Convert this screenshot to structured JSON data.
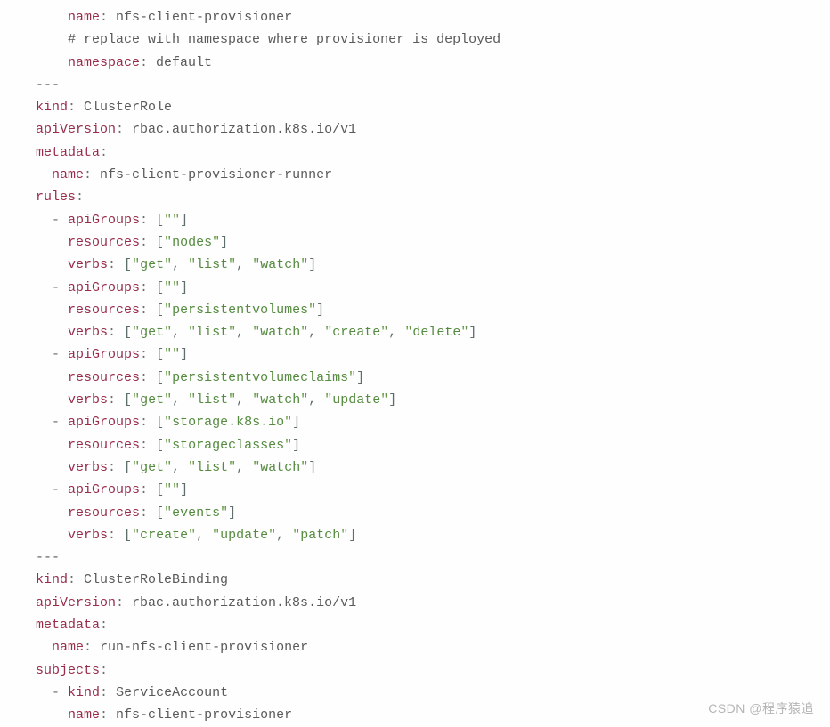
{
  "watermark": "CSDN @程序猿追",
  "lines": [
    {
      "indent": "    ",
      "tokens": [
        {
          "t": "key",
          "v": "name"
        },
        {
          "t": "col",
          "v": ": "
        },
        {
          "t": "pl",
          "v": "nfs-client-provisioner"
        }
      ]
    },
    {
      "indent": "    ",
      "tokens": [
        {
          "t": "pl",
          "v": "# replace with namespace where provisioner is deployed"
        }
      ]
    },
    {
      "indent": "    ",
      "tokens": [
        {
          "t": "key",
          "v": "namespace"
        },
        {
          "t": "col",
          "v": ": "
        },
        {
          "t": "pl",
          "v": "default"
        }
      ]
    },
    {
      "indent": "",
      "tokens": [
        {
          "t": "sep",
          "v": "---"
        }
      ]
    },
    {
      "indent": "",
      "tokens": [
        {
          "t": "key",
          "v": "kind"
        },
        {
          "t": "col",
          "v": ": "
        },
        {
          "t": "pl",
          "v": "ClusterRole"
        }
      ]
    },
    {
      "indent": "",
      "tokens": [
        {
          "t": "key",
          "v": "apiVersion"
        },
        {
          "t": "col",
          "v": ": "
        },
        {
          "t": "pl",
          "v": "rbac.authorization.k8s.io/v1"
        }
      ]
    },
    {
      "indent": "",
      "tokens": [
        {
          "t": "key",
          "v": "metadata"
        },
        {
          "t": "col",
          "v": ":"
        }
      ]
    },
    {
      "indent": "  ",
      "tokens": [
        {
          "t": "key",
          "v": "name"
        },
        {
          "t": "col",
          "v": ": "
        },
        {
          "t": "pl",
          "v": "nfs-client-provisioner-runner"
        }
      ]
    },
    {
      "indent": "",
      "tokens": [
        {
          "t": "key",
          "v": "rules"
        },
        {
          "t": "col",
          "v": ":"
        }
      ]
    },
    {
      "indent": "  ",
      "tokens": [
        {
          "t": "dash",
          "v": "- "
        },
        {
          "t": "key",
          "v": "apiGroups"
        },
        {
          "t": "col",
          "v": ": "
        },
        {
          "t": "b",
          "v": "["
        },
        {
          "t": "q",
          "v": "\""
        },
        {
          "t": "s",
          "v": ""
        },
        {
          "t": "q",
          "v": "\""
        },
        {
          "t": "b",
          "v": "]"
        }
      ]
    },
    {
      "indent": "    ",
      "tokens": [
        {
          "t": "key",
          "v": "resources"
        },
        {
          "t": "col",
          "v": ": "
        },
        {
          "t": "b",
          "v": "["
        },
        {
          "t": "q",
          "v": "\""
        },
        {
          "t": "s",
          "v": "nodes"
        },
        {
          "t": "q",
          "v": "\""
        },
        {
          "t": "b",
          "v": "]"
        }
      ]
    },
    {
      "indent": "    ",
      "tokens": [
        {
          "t": "key",
          "v": "verbs"
        },
        {
          "t": "col",
          "v": ": "
        },
        {
          "t": "b",
          "v": "["
        },
        {
          "t": "q",
          "v": "\""
        },
        {
          "t": "s",
          "v": "get"
        },
        {
          "t": "q",
          "v": "\""
        },
        {
          "t": "b",
          "v": ", "
        },
        {
          "t": "q",
          "v": "\""
        },
        {
          "t": "s",
          "v": "list"
        },
        {
          "t": "q",
          "v": "\""
        },
        {
          "t": "b",
          "v": ", "
        },
        {
          "t": "q",
          "v": "\""
        },
        {
          "t": "s",
          "v": "watch"
        },
        {
          "t": "q",
          "v": "\""
        },
        {
          "t": "b",
          "v": "]"
        }
      ]
    },
    {
      "indent": "  ",
      "tokens": [
        {
          "t": "dash",
          "v": "- "
        },
        {
          "t": "key",
          "v": "apiGroups"
        },
        {
          "t": "col",
          "v": ": "
        },
        {
          "t": "b",
          "v": "["
        },
        {
          "t": "q",
          "v": "\""
        },
        {
          "t": "s",
          "v": ""
        },
        {
          "t": "q",
          "v": "\""
        },
        {
          "t": "b",
          "v": "]"
        }
      ]
    },
    {
      "indent": "    ",
      "tokens": [
        {
          "t": "key",
          "v": "resources"
        },
        {
          "t": "col",
          "v": ": "
        },
        {
          "t": "b",
          "v": "["
        },
        {
          "t": "q",
          "v": "\""
        },
        {
          "t": "s",
          "v": "persistentvolumes"
        },
        {
          "t": "q",
          "v": "\""
        },
        {
          "t": "b",
          "v": "]"
        }
      ]
    },
    {
      "indent": "    ",
      "tokens": [
        {
          "t": "key",
          "v": "verbs"
        },
        {
          "t": "col",
          "v": ": "
        },
        {
          "t": "b",
          "v": "["
        },
        {
          "t": "q",
          "v": "\""
        },
        {
          "t": "s",
          "v": "get"
        },
        {
          "t": "q",
          "v": "\""
        },
        {
          "t": "b",
          "v": ", "
        },
        {
          "t": "q",
          "v": "\""
        },
        {
          "t": "s",
          "v": "list"
        },
        {
          "t": "q",
          "v": "\""
        },
        {
          "t": "b",
          "v": ", "
        },
        {
          "t": "q",
          "v": "\""
        },
        {
          "t": "s",
          "v": "watch"
        },
        {
          "t": "q",
          "v": "\""
        },
        {
          "t": "b",
          "v": ", "
        },
        {
          "t": "q",
          "v": "\""
        },
        {
          "t": "s",
          "v": "create"
        },
        {
          "t": "q",
          "v": "\""
        },
        {
          "t": "b",
          "v": ", "
        },
        {
          "t": "q",
          "v": "\""
        },
        {
          "t": "s",
          "v": "delete"
        },
        {
          "t": "q",
          "v": "\""
        },
        {
          "t": "b",
          "v": "]"
        }
      ]
    },
    {
      "indent": "  ",
      "tokens": [
        {
          "t": "dash",
          "v": "- "
        },
        {
          "t": "key",
          "v": "apiGroups"
        },
        {
          "t": "col",
          "v": ": "
        },
        {
          "t": "b",
          "v": "["
        },
        {
          "t": "q",
          "v": "\""
        },
        {
          "t": "s",
          "v": ""
        },
        {
          "t": "q",
          "v": "\""
        },
        {
          "t": "b",
          "v": "]"
        }
      ]
    },
    {
      "indent": "    ",
      "tokens": [
        {
          "t": "key",
          "v": "resources"
        },
        {
          "t": "col",
          "v": ": "
        },
        {
          "t": "b",
          "v": "["
        },
        {
          "t": "q",
          "v": "\""
        },
        {
          "t": "s",
          "v": "persistentvolumeclaims"
        },
        {
          "t": "q",
          "v": "\""
        },
        {
          "t": "b",
          "v": "]"
        }
      ]
    },
    {
      "indent": "    ",
      "tokens": [
        {
          "t": "key",
          "v": "verbs"
        },
        {
          "t": "col",
          "v": ": "
        },
        {
          "t": "b",
          "v": "["
        },
        {
          "t": "q",
          "v": "\""
        },
        {
          "t": "s",
          "v": "get"
        },
        {
          "t": "q",
          "v": "\""
        },
        {
          "t": "b",
          "v": ", "
        },
        {
          "t": "q",
          "v": "\""
        },
        {
          "t": "s",
          "v": "list"
        },
        {
          "t": "q",
          "v": "\""
        },
        {
          "t": "b",
          "v": ", "
        },
        {
          "t": "q",
          "v": "\""
        },
        {
          "t": "s",
          "v": "watch"
        },
        {
          "t": "q",
          "v": "\""
        },
        {
          "t": "b",
          "v": ", "
        },
        {
          "t": "q",
          "v": "\""
        },
        {
          "t": "s",
          "v": "update"
        },
        {
          "t": "q",
          "v": "\""
        },
        {
          "t": "b",
          "v": "]"
        }
      ]
    },
    {
      "indent": "  ",
      "tokens": [
        {
          "t": "dash",
          "v": "- "
        },
        {
          "t": "key",
          "v": "apiGroups"
        },
        {
          "t": "col",
          "v": ": "
        },
        {
          "t": "b",
          "v": "["
        },
        {
          "t": "q",
          "v": "\""
        },
        {
          "t": "s",
          "v": "storage.k8s.io"
        },
        {
          "t": "q",
          "v": "\""
        },
        {
          "t": "b",
          "v": "]"
        }
      ]
    },
    {
      "indent": "    ",
      "tokens": [
        {
          "t": "key",
          "v": "resources"
        },
        {
          "t": "col",
          "v": ": "
        },
        {
          "t": "b",
          "v": "["
        },
        {
          "t": "q",
          "v": "\""
        },
        {
          "t": "s",
          "v": "storageclasses"
        },
        {
          "t": "q",
          "v": "\""
        },
        {
          "t": "b",
          "v": "]"
        }
      ]
    },
    {
      "indent": "    ",
      "tokens": [
        {
          "t": "key",
          "v": "verbs"
        },
        {
          "t": "col",
          "v": ": "
        },
        {
          "t": "b",
          "v": "["
        },
        {
          "t": "q",
          "v": "\""
        },
        {
          "t": "s",
          "v": "get"
        },
        {
          "t": "q",
          "v": "\""
        },
        {
          "t": "b",
          "v": ", "
        },
        {
          "t": "q",
          "v": "\""
        },
        {
          "t": "s",
          "v": "list"
        },
        {
          "t": "q",
          "v": "\""
        },
        {
          "t": "b",
          "v": ", "
        },
        {
          "t": "q",
          "v": "\""
        },
        {
          "t": "s",
          "v": "watch"
        },
        {
          "t": "q",
          "v": "\""
        },
        {
          "t": "b",
          "v": "]"
        }
      ]
    },
    {
      "indent": "  ",
      "tokens": [
        {
          "t": "dash",
          "v": "- "
        },
        {
          "t": "key",
          "v": "apiGroups"
        },
        {
          "t": "col",
          "v": ": "
        },
        {
          "t": "b",
          "v": "["
        },
        {
          "t": "q",
          "v": "\""
        },
        {
          "t": "s",
          "v": ""
        },
        {
          "t": "q",
          "v": "\""
        },
        {
          "t": "b",
          "v": "]"
        }
      ]
    },
    {
      "indent": "    ",
      "tokens": [
        {
          "t": "key",
          "v": "resources"
        },
        {
          "t": "col",
          "v": ": "
        },
        {
          "t": "b",
          "v": "["
        },
        {
          "t": "q",
          "v": "\""
        },
        {
          "t": "s",
          "v": "events"
        },
        {
          "t": "q",
          "v": "\""
        },
        {
          "t": "b",
          "v": "]"
        }
      ]
    },
    {
      "indent": "    ",
      "tokens": [
        {
          "t": "key",
          "v": "verbs"
        },
        {
          "t": "col",
          "v": ": "
        },
        {
          "t": "b",
          "v": "["
        },
        {
          "t": "q",
          "v": "\""
        },
        {
          "t": "s",
          "v": "create"
        },
        {
          "t": "q",
          "v": "\""
        },
        {
          "t": "b",
          "v": ", "
        },
        {
          "t": "q",
          "v": "\""
        },
        {
          "t": "s",
          "v": "update"
        },
        {
          "t": "q",
          "v": "\""
        },
        {
          "t": "b",
          "v": ", "
        },
        {
          "t": "q",
          "v": "\""
        },
        {
          "t": "s",
          "v": "patch"
        },
        {
          "t": "q",
          "v": "\""
        },
        {
          "t": "b",
          "v": "]"
        }
      ]
    },
    {
      "indent": "",
      "tokens": [
        {
          "t": "sep",
          "v": "---"
        }
      ]
    },
    {
      "indent": "",
      "tokens": [
        {
          "t": "key",
          "v": "kind"
        },
        {
          "t": "col",
          "v": ": "
        },
        {
          "t": "pl",
          "v": "ClusterRoleBinding"
        }
      ]
    },
    {
      "indent": "",
      "tokens": [
        {
          "t": "key",
          "v": "apiVersion"
        },
        {
          "t": "col",
          "v": ": "
        },
        {
          "t": "pl",
          "v": "rbac.authorization.k8s.io/v1"
        }
      ]
    },
    {
      "indent": "",
      "tokens": [
        {
          "t": "key",
          "v": "metadata"
        },
        {
          "t": "col",
          "v": ":"
        }
      ]
    },
    {
      "indent": "  ",
      "tokens": [
        {
          "t": "key",
          "v": "name"
        },
        {
          "t": "col",
          "v": ": "
        },
        {
          "t": "pl",
          "v": "run-nfs-client-provisioner"
        }
      ]
    },
    {
      "indent": "",
      "tokens": [
        {
          "t": "key",
          "v": "subjects"
        },
        {
          "t": "col",
          "v": ":"
        }
      ]
    },
    {
      "indent": "  ",
      "tokens": [
        {
          "t": "dash",
          "v": "- "
        },
        {
          "t": "key",
          "v": "kind"
        },
        {
          "t": "col",
          "v": ": "
        },
        {
          "t": "pl",
          "v": "ServiceAccount"
        }
      ]
    },
    {
      "indent": "    ",
      "tokens": [
        {
          "t": "key",
          "v": "name"
        },
        {
          "t": "col",
          "v": ": "
        },
        {
          "t": "pl",
          "v": "nfs-client-provisioner"
        }
      ]
    }
  ]
}
